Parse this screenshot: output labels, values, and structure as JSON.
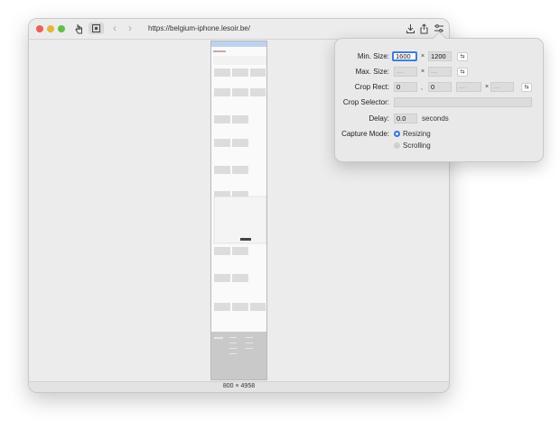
{
  "toolbar": {
    "url": "https://belgium-iphone.lesoir.be/",
    "pointer_icon": "hand-pointer-icon",
    "capture_icon": "capture-target-icon",
    "back_icon": "chevron-left-icon",
    "forward_icon": "chevron-right-icon",
    "download_icon": "download-icon",
    "share_icon": "share-icon",
    "settings_icon": "settings-sliders-icon"
  },
  "status": {
    "dimensions": "800 × 4958"
  },
  "settings": {
    "min_size_label": "Min. Size:",
    "min_width": "1600",
    "min_height": "1200",
    "max_size_label": "Max. Size:",
    "max_width_placeholder": "—",
    "max_height_placeholder": "—",
    "crop_rect_label": "Crop Rect:",
    "crop_x": "0",
    "crop_y": "0",
    "crop_w_placeholder": "—",
    "crop_h_placeholder": "—",
    "crop_selector_label": "Crop Selector:",
    "crop_selector_value": "",
    "delay_label": "Delay:",
    "delay_value": "0.0",
    "delay_unit": "seconds",
    "capture_mode_label": "Capture Mode:",
    "mode_resizing": "Resizing",
    "mode_scrolling": "Scrolling",
    "selected_mode": "Resizing",
    "x_sep": "×",
    "comma_sep": ","
  }
}
